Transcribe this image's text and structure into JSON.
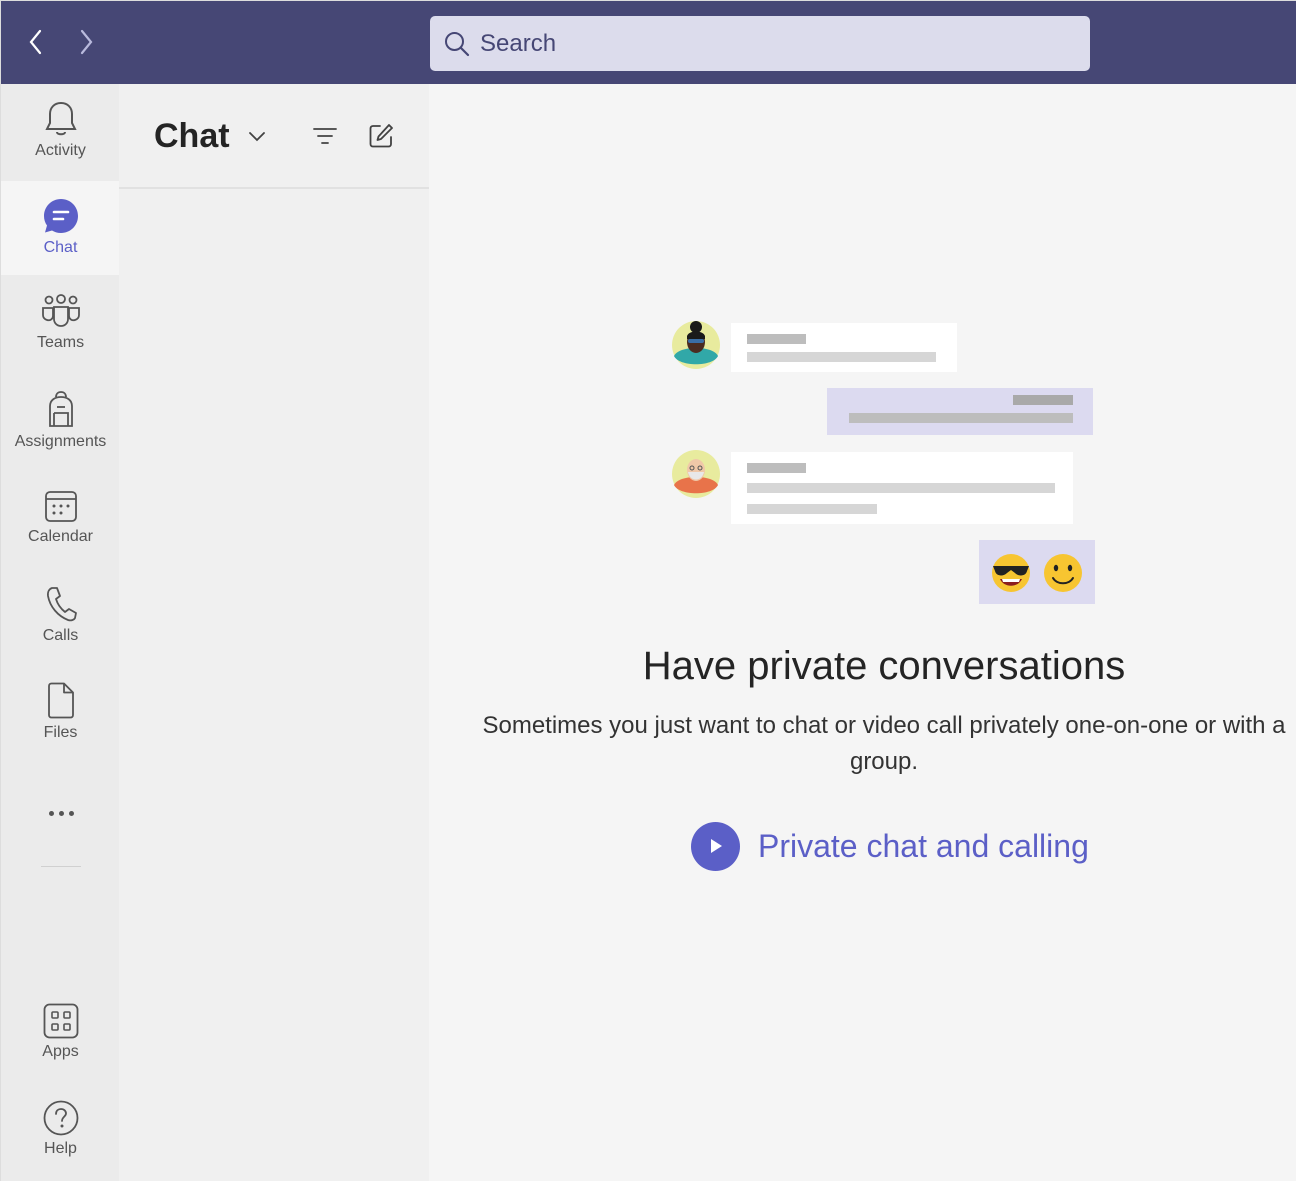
{
  "topbar": {
    "search_placeholder": "Search"
  },
  "rail": {
    "items": [
      {
        "label": "Activity"
      },
      {
        "label": "Chat"
      },
      {
        "label": "Teams"
      },
      {
        "label": "Assignments"
      },
      {
        "label": "Calendar"
      },
      {
        "label": "Calls"
      },
      {
        "label": "Files"
      }
    ],
    "bottom": [
      {
        "label": "Apps"
      },
      {
        "label": "Help"
      }
    ],
    "active": "Chat"
  },
  "list": {
    "title": "Chat"
  },
  "main": {
    "heading": "Have private conversations",
    "description": "Sometimes you just want to chat or video call privately one-on-one or with a group.",
    "cta_label": "Private chat and calling"
  },
  "colors": {
    "topbar": "#464775",
    "accent": "#5b5fc7",
    "rail_bg": "#ebebeb",
    "main_bg": "#f5f5f5"
  }
}
